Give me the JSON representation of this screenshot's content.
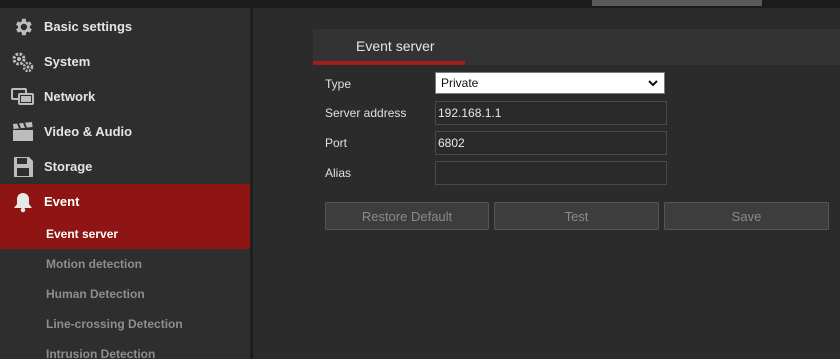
{
  "sidebar": {
    "items": [
      {
        "label": "Basic settings",
        "icon": "gear-icon"
      },
      {
        "label": "System",
        "icon": "gears-icon"
      },
      {
        "label": "Network",
        "icon": "network-icon"
      },
      {
        "label": "Video & Audio",
        "icon": "clapperboard-icon"
      },
      {
        "label": "Storage",
        "icon": "floppy-icon"
      },
      {
        "label": "Event",
        "icon": "bell-icon"
      }
    ],
    "sub_items": [
      {
        "label": "Event server"
      },
      {
        "label": "Motion detection"
      },
      {
        "label": "Human Detection"
      },
      {
        "label": "Line-crossing Detection"
      },
      {
        "label": "Intrusion Detection"
      }
    ]
  },
  "tabs": [
    {
      "label": "Event server"
    }
  ],
  "form": {
    "type": {
      "label": "Type",
      "value": "Private"
    },
    "server_address": {
      "label": "Server address",
      "value": "192.168.1.1"
    },
    "port": {
      "label": "Port",
      "value": "6802"
    },
    "alias": {
      "label": "Alias",
      "value": ""
    }
  },
  "buttons": {
    "restore": "Restore Default",
    "test": "Test",
    "save": "Save"
  },
  "colors": {
    "accent": "#8f1414",
    "tab_underline": "#a31c1c",
    "background": "#2b2b2b"
  }
}
